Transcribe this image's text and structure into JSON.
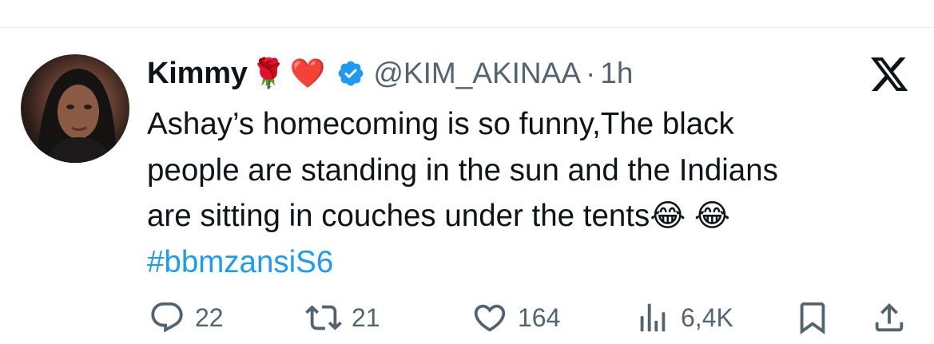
{
  "tweet": {
    "author_name": "Kimmy",
    "name_emojis": [
      "🌹",
      "❤️"
    ],
    "handle": "@KIM_AKINAA",
    "separator": "·",
    "time": "1h",
    "text_lines": [
      "Ashay’s homecoming is so funny,The black",
      "people are standing in the sun and the Indians",
      "are sitting in couches under the tents😂 😂"
    ],
    "hashtag": "#bbmzansiS6"
  },
  "actions": {
    "replies": "22",
    "retweets": "21",
    "likes": "164",
    "views": "6,4K"
  },
  "icons": {
    "verified": "verified-badge-icon",
    "logo": "x-logo-icon",
    "reply": "reply-icon",
    "retweet": "retweet-icon",
    "like": "heart-icon",
    "views": "views-chart-icon",
    "bookmark": "bookmark-icon",
    "share": "share-icon"
  },
  "colors": {
    "text": "#0f1419",
    "secondary": "#536471",
    "accent": "#1d9bf0"
  }
}
